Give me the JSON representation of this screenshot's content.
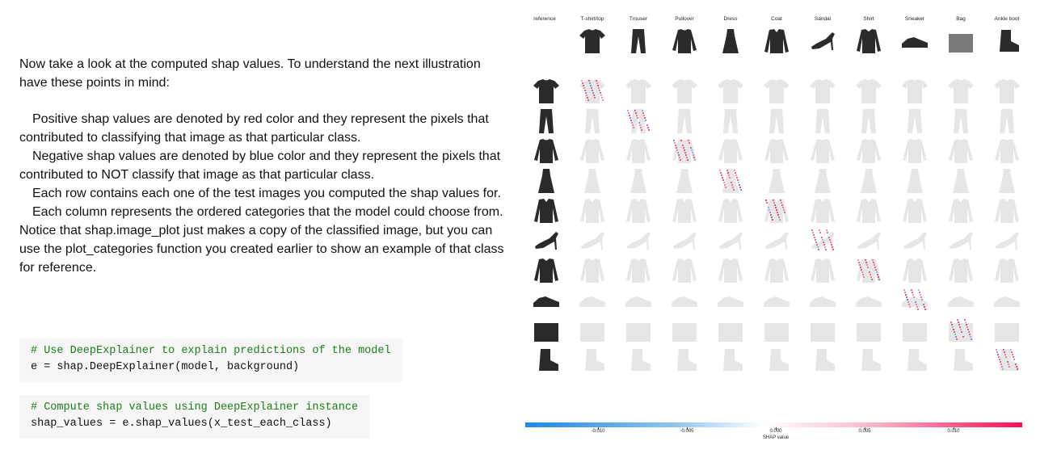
{
  "text": {
    "intro": "Now take a look at the computed shap values. To understand the next illustration have these points in mind:",
    "bullets": [
      "Positive shap values are denoted by red color and they represent the pixels that contributed to classifying that image as that particular class.",
      "Negative shap values are denoted by blue color and they represent the pixels that contributed to NOT classify that image as that particular class.",
      "Each row contains each one of the test images you computed the shap values for.",
      "Each column represents the ordered categories that the model could choose from. Notice that shap.image_plot just makes a copy of the classified image, but you can use the plot_categories function you created earlier to show an example of that class for reference."
    ]
  },
  "code": [
    {
      "comment": "# Use DeepExplainer to explain predictions of the model",
      "line": "e = shap.DeepExplainer(model, background)"
    },
    {
      "comment": "# Compute shap values using DeepExplainer instance",
      "line": "shap_values = e.shap_values(x_test_each_class)"
    }
  ],
  "figure": {
    "reference_label": "reference",
    "classes": [
      "T-shirt/top",
      "Trouser",
      "Pullover",
      "Dress",
      "Coat",
      "Sandal",
      "Shirt",
      "Sneaker",
      "Bag",
      "Ankle boot"
    ],
    "rows": [
      "T-shirt/top",
      "Trouser",
      "Pullover",
      "Dress",
      "Coat",
      "Sandal",
      "Shirt",
      "Sneaker",
      "Bag",
      "Ankle boot"
    ],
    "colorbar": {
      "label": "SHAP value",
      "ticks": [
        "-0.010",
        "-0.005",
        "0.000",
        "0.005",
        "0.010"
      ],
      "colors": {
        "negative": "#1e88e5",
        "positive": "#ff0d57"
      }
    }
  }
}
